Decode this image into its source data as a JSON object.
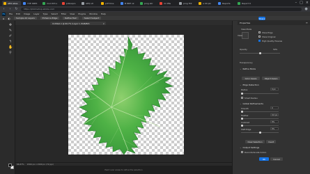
{
  "browser": {
    "tabs": [
      {
        "label": "AEO abas"
      },
      {
        "label": "YVE 9983"
      },
      {
        "label": "mod 4th s"
      },
      {
        "label": "pillowpro"
      },
      {
        "label": "APQ sit"
      },
      {
        "label": "pdf trios"
      },
      {
        "label": "B 8DE ok"
      },
      {
        "label": "prog stir"
      },
      {
        "label": "mi 9fw"
      },
      {
        "label": "prog fldr"
      },
      {
        "label": "a 00 pln"
      },
      {
        "label": "Reports"
      },
      {
        "label": "Report 9"
      }
    ],
    "url": "https://photoshop.adobe.com"
  },
  "menu": {
    "items": [
      "File",
      "Edit",
      "Image",
      "Layer",
      "Type",
      "Select",
      "Filter",
      "View",
      "Plugins",
      "Window",
      "Help"
    ]
  },
  "options": {
    "items": [
      "Sample All Layers",
      "Enhance Edge",
      "Refine Hair",
      "Select Subject"
    ],
    "share": "Share"
  },
  "document": {
    "tab_label": "Untitled-1 @ 66.7% (Layer 1, RGB/8#)"
  },
  "status": {
    "zoom": "66.67%",
    "info": "1500 px x 1500 px (72 ppi)"
  },
  "hint": "Paint over areas to refine the selection",
  "panel": {
    "title": "Properties",
    "view_mode": "View Mode",
    "show_edge": "Show Edge",
    "show_original": "Show Original",
    "high_quality": "High Quality Preview",
    "opacity_label": "Opacity",
    "opacity_value": "50%",
    "transparency_label": "Transparency",
    "refine_mode": "Refine Mode",
    "color_aware": "Color Aware",
    "object_aware": "Object Aware",
    "edge_detection": "Edge Detection",
    "radius_label": "Radius",
    "radius_value": "0 px",
    "smart_radius": "Smart Radius",
    "global_refinements": "Global Refinements",
    "smooth_label": "Smooth",
    "smooth_value": "0",
    "feather_label": "Feather",
    "feather_value": "0.0 px",
    "contrast_label": "Contrast",
    "contrast_value": "0%",
    "shift_edge_label": "Shift Edge",
    "shift_edge_value": "0%",
    "clear_selection": "Clear Selection",
    "invert": "Invert",
    "output_settings": "Output Settings",
    "decontaminate": "Decontaminate Colors",
    "ok": "OK",
    "cancel": "Cancel"
  }
}
